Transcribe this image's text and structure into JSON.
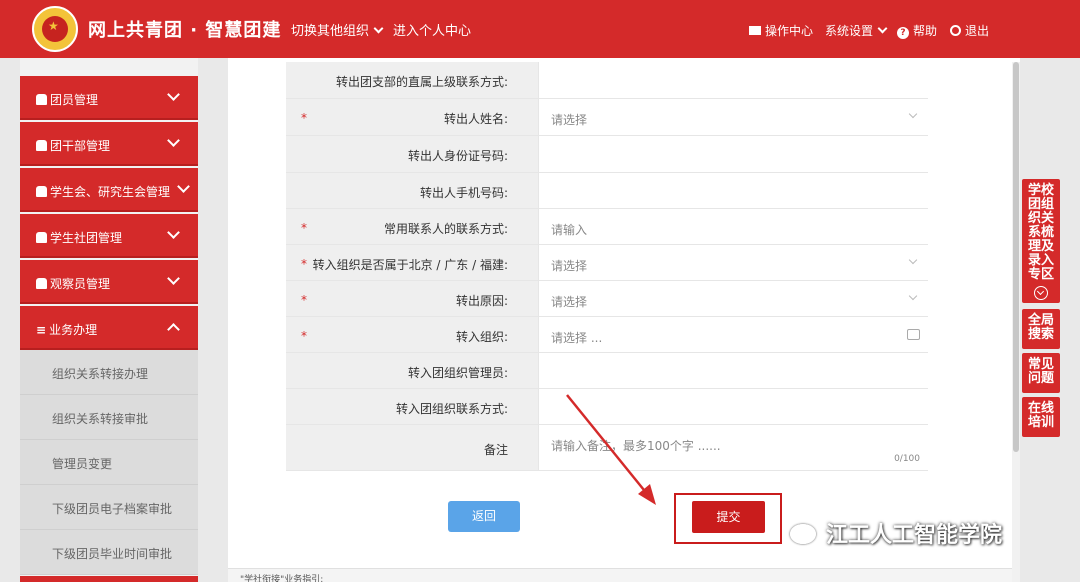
{
  "header": {
    "title": "网上共青团 · 智慧团建",
    "switch_org": "切换其他组织",
    "personal_center": "进入个人中心",
    "ops_center": "操作中心",
    "system_settings": "系统设置",
    "help": "帮助",
    "logout": "退出"
  },
  "sidebar": {
    "items": [
      {
        "label": "团员管理"
      },
      {
        "label": "团干部管理"
      },
      {
        "label": "学生会、研究生会管理"
      },
      {
        "label": "学生社团管理"
      },
      {
        "label": "观察员管理"
      },
      {
        "label": "业务办理"
      }
    ],
    "sub_items": [
      {
        "label": "组织关系转接办理"
      },
      {
        "label": "组织关系转接审批"
      },
      {
        "label": "管理员变更"
      },
      {
        "label": "下级团员电子档案审批"
      },
      {
        "label": "下级团员毕业时间审批"
      }
    ]
  },
  "form": {
    "rows": [
      {
        "label": "转出团支部的直属上级联系方式:",
        "required": false,
        "placeholder": ""
      },
      {
        "label": "转出人姓名:",
        "required": true,
        "placeholder": "请选择"
      },
      {
        "label": "转出人身份证号码:",
        "required": false,
        "placeholder": ""
      },
      {
        "label": "转出人手机号码:",
        "required": false,
        "placeholder": ""
      },
      {
        "label": "常用联系人的联系方式:",
        "required": true,
        "placeholder": "请输入"
      },
      {
        "label": "转入组织是否属于北京 / 广东 / 福建:",
        "required": true,
        "placeholder": "请选择"
      },
      {
        "label": "转出原因:",
        "required": true,
        "placeholder": "请选择"
      },
      {
        "label": "转入组织:",
        "required": true,
        "placeholder": "请选择 ..."
      },
      {
        "label": "转入团组织管理员:",
        "required": false,
        "placeholder": ""
      },
      {
        "label": "转入团组织联系方式:",
        "required": false,
        "placeholder": ""
      },
      {
        "label": "备注",
        "required": false,
        "placeholder": "请输入备注，最多100个字 ......"
      }
    ],
    "required_mark": "*",
    "remark_counter": "0/100",
    "back_label": "返回",
    "submit_label": "提交"
  },
  "guide": {
    "text": "\"学社衔接\"业务指引:"
  },
  "float_panel": [
    {
      "label": "学校团组织关系梳理及录入专区"
    },
    {
      "label": "全局搜索"
    },
    {
      "label": "常见问题"
    },
    {
      "label": "在线培训"
    }
  ],
  "watermark": "江工人工智能学院",
  "colors": {
    "primary_red": "#d42a2a",
    "submit_red": "#c91c1c",
    "back_blue": "#5aa4e8"
  }
}
